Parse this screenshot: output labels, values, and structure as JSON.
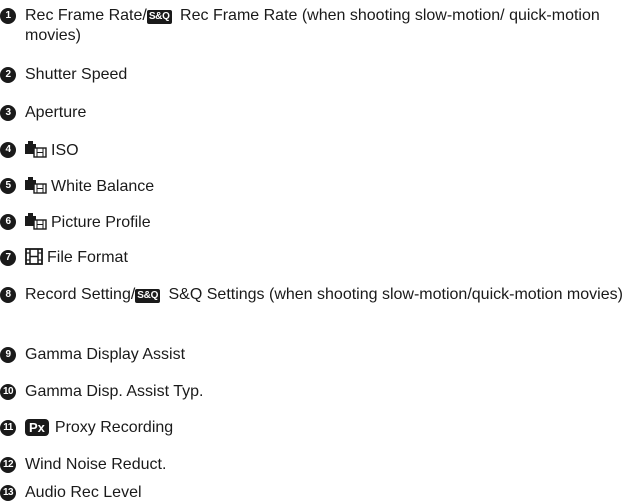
{
  "items": [
    {
      "num": "1",
      "pre": "Rec Frame Rate/",
      "badge": "S&Q",
      "text": " Rec Frame Rate (when shooting slow-motion/ quick-motion movies)"
    },
    {
      "num": "2",
      "text": "Shutter Speed"
    },
    {
      "num": "3",
      "text": "Aperture"
    },
    {
      "num": "4",
      "icon": "camera-movie-mode-icon",
      "text": "ISO"
    },
    {
      "num": "5",
      "icon": "camera-movie-mode-icon",
      "text": "White Balance"
    },
    {
      "num": "6",
      "icon": "camera-movie-mode-icon",
      "text": "Picture Profile"
    },
    {
      "num": "7",
      "icon": "film-strip-icon",
      "text": "File Format"
    },
    {
      "num": "8",
      "pre": "Record Setting/",
      "badge": "S&Q",
      "text": " S&Q Settings (when shooting slow-motion/quick-motion movies)"
    },
    {
      "num": "9",
      "text": "Gamma Display Assist"
    },
    {
      "num": "10",
      "text": "Gamma Disp. Assist Typ."
    },
    {
      "num": "11",
      "badge": "Px",
      "text": "Proxy Recording"
    },
    {
      "num": "12",
      "text": "Wind Noise Reduct."
    },
    {
      "num": "13",
      "text": "Audio Rec Level"
    }
  ]
}
